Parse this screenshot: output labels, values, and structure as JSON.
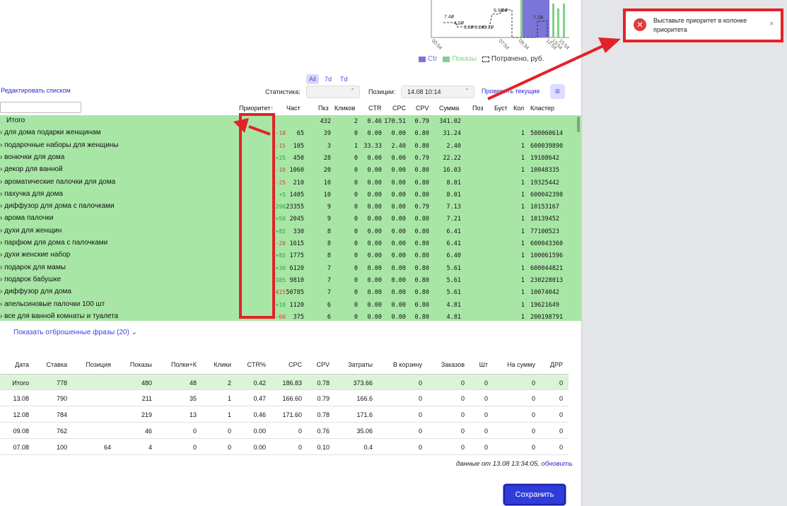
{
  "chart": {
    "point_labels": [
      "7.4₽",
      "4.8₽",
      "3.2₽",
      "3.2₽",
      "3.2₽",
      "9.9₽",
      "0₽",
      "7.2₽"
    ],
    "x_labels": [
      "00:54",
      "07:54",
      "09:34",
      "12:54",
      "13:54",
      "15:54"
    ],
    "legend": [
      {
        "label": "Ctr",
        "color": "#7b74d9"
      },
      {
        "label": "Показы",
        "color": "#7fd08a"
      },
      {
        "label": "Потрачено, руб.",
        "color": "#333333"
      }
    ]
  },
  "toolbar": {
    "range_tabs": [
      "All",
      "7d",
      "Td"
    ],
    "edit_list": "Редактировать списком",
    "stat_label": "Статистика:",
    "stat_value": "",
    "pos_label": "Позиции:",
    "pos_value": "14.08 10:14",
    "check_current": "Проверить текущие",
    "menu_icon": "≡"
  },
  "kw_headers": {
    "priority": "Приоритет",
    "priority_arrow": "↑",
    "freq": "Част",
    "pkz": "Пкз",
    "clicks": "Кликов",
    "ctr": "CTR",
    "cpc": "CPC",
    "cpv": "CPV",
    "sum": "Сумма",
    "pos": "Поз",
    "boost": "Буст",
    "kol": "Кол",
    "cluster": "Кластер"
  },
  "kw_total": {
    "name": "Итого",
    "pkz": "432",
    "clicks": "2",
    "ctr": "0.46",
    "cpc": "170.51",
    "cpv": "0.79",
    "sum": "341.02"
  },
  "keywords": [
    {
      "name": "для дома подарки женщинам",
      "delta": "-10",
      "freq": "65",
      "pkz": "39",
      "clicks": "0",
      "ctr": "0.00",
      "cpc": "0.00",
      "cpv": "0.80",
      "sum": "31.24",
      "kol": "1",
      "cluster": "500060614"
    },
    {
      "name": "подарочные наборы для женщины",
      "delta": "-15",
      "freq": "105",
      "pkz": "3",
      "clicks": "1",
      "ctr": "33.33",
      "cpc": "2.40",
      "cpv": "0.80",
      "sum": "2.40",
      "kol": "1",
      "cluster": "600039890"
    },
    {
      "name": "вонючки для дома",
      "delta": "+25",
      "freq": "450",
      "pkz": "28",
      "clicks": "0",
      "ctr": "0.00",
      "cpc": "0.00",
      "cpv": "0.79",
      "sum": "22.22",
      "kol": "1",
      "cluster": "19188642"
    },
    {
      "name": "декор для ванной",
      "delta": "-10",
      "freq": "1060",
      "pkz": "20",
      "clicks": "0",
      "ctr": "0.00",
      "cpc": "0.00",
      "cpv": "0.80",
      "sum": "16.03",
      "kol": "1",
      "cluster": "10048335"
    },
    {
      "name": "ароматические палочки для дома",
      "delta": "-25",
      "freq": "210",
      "pkz": "10",
      "clicks": "0",
      "ctr": "0.00",
      "cpc": "0.00",
      "cpv": "0.80",
      "sum": "8.01",
      "kol": "1",
      "cluster": "19325442"
    },
    {
      "name": "пахучка для дома",
      "delta": "+5",
      "freq": "1405",
      "pkz": "10",
      "clicks": "0",
      "ctr": "0.00",
      "cpc": "0.00",
      "cpv": "0.80",
      "sum": "8.01",
      "kol": "1",
      "cluster": "600042398"
    },
    {
      "name": "диффузор для дома с палочками",
      "delta": "+290",
      "freq": "23355",
      "pkz": "9",
      "clicks": "0",
      "ctr": "0.00",
      "cpc": "0.00",
      "cpv": "0.79",
      "sum": "7.13",
      "kol": "1",
      "cluster": "10153167"
    },
    {
      "name": "арома палочки",
      "delta": "+50",
      "freq": "2045",
      "pkz": "9",
      "clicks": "0",
      "ctr": "0.00",
      "cpc": "0.00",
      "cpv": "0.80",
      "sum": "7.21",
      "kol": "1",
      "cluster": "10139452"
    },
    {
      "name": "духи для женщин",
      "delta": "+85",
      "freq": "330",
      "pkz": "8",
      "clicks": "0",
      "ctr": "0.00",
      "cpc": "0.00",
      "cpv": "0.80",
      "sum": "6.41",
      "kol": "1",
      "cluster": "77100523"
    },
    {
      "name": "парфюм для дома с палочками",
      "delta": "-20",
      "freq": "1615",
      "pkz": "8",
      "clicks": "0",
      "ctr": "0.00",
      "cpc": "0.00",
      "cpv": "0.80",
      "sum": "6.41",
      "kol": "1",
      "cluster": "600043360"
    },
    {
      "name": "духи женские набор",
      "delta": "+85",
      "freq": "1775",
      "pkz": "8",
      "clicks": "0",
      "ctr": "0.00",
      "cpc": "0.00",
      "cpv": "0.80",
      "sum": "6.40",
      "kol": "1",
      "cluster": "100061596"
    },
    {
      "name": "подарок для мамы",
      "delta": "+30",
      "freq": "6120",
      "pkz": "7",
      "clicks": "0",
      "ctr": "0.00",
      "cpc": "0.00",
      "cpv": "0.80",
      "sum": "5.61",
      "kol": "1",
      "cluster": "600044821"
    },
    {
      "name": "подарок бабушке",
      "delta": "+185",
      "freq": "9810",
      "pkz": "7",
      "clicks": "0",
      "ctr": "0.00",
      "cpc": "0.00",
      "cpv": "0.80",
      "sum": "5.61",
      "kol": "1",
      "cluster": "230228013"
    },
    {
      "name": "диффузор для дома",
      "delta": "-415",
      "freq": "50785",
      "pkz": "7",
      "clicks": "0",
      "ctr": "0.00",
      "cpc": "0.00",
      "cpv": "0.80",
      "sum": "5.61",
      "kol": "1",
      "cluster": "10074042"
    },
    {
      "name": "апельсиновые палочки 100 шт",
      "delta": "+10",
      "freq": "1120",
      "pkz": "6",
      "clicks": "0",
      "ctr": "0.00",
      "cpc": "0.00",
      "cpv": "0.80",
      "sum": "4.81",
      "kol": "1",
      "cluster": "19621649"
    },
    {
      "name": "все для ванной комнаты и туалета",
      "delta": "-60",
      "freq": "375",
      "pkz": "6",
      "clicks": "0",
      "ctr": "0.00",
      "cpc": "0.00",
      "cpv": "0.80",
      "sum": "4.81",
      "kol": "1",
      "cluster": "200198791"
    }
  ],
  "dropped_phrases": "Показать отброшенные фразы (20)",
  "stats_headers": [
    "Дата",
    "Ставка",
    "Позиция",
    "Показы",
    "Полки+К",
    "Клики",
    "CTR%",
    "CPC",
    "CPV",
    "Затраты",
    "В корзину",
    "Заказов",
    "Шт",
    "На сумму",
    "ДРР"
  ],
  "stats_rows": [
    [
      "Итого",
      "778",
      "",
      "480",
      "48",
      "2",
      "0.42",
      "186.83",
      "0.78",
      "373.66",
      "0",
      "0",
      "0",
      "0",
      "0"
    ],
    [
      "13.08",
      "790",
      "",
      "211",
      "35",
      "1",
      "0.47",
      "166.60",
      "0.79",
      "166.6",
      "0",
      "0",
      "0",
      "0",
      "0"
    ],
    [
      "12.08",
      "784",
      "",
      "219",
      "13",
      "1",
      "0.46",
      "171.60",
      "0.78",
      "171.6",
      "0",
      "0",
      "0",
      "0",
      "0"
    ],
    [
      "09.08",
      "762",
      "",
      "46",
      "0",
      "0",
      "0.00",
      "0",
      "0.76",
      "35.06",
      "0",
      "0",
      "0",
      "0",
      "0"
    ],
    [
      "07.08",
      "100",
      "64",
      "4",
      "0",
      "0",
      "0.00",
      "0",
      "0.10",
      "0.4",
      "0",
      "0",
      "0",
      "0",
      "0"
    ]
  ],
  "data_from": {
    "text": "данные от 13.08 13:34:05,",
    "link": "обновить"
  },
  "save_button": "Сохранить",
  "toast": {
    "message": "Выставьте приоритет в колонке приоритета",
    "close": "×",
    "icon": "✕"
  }
}
